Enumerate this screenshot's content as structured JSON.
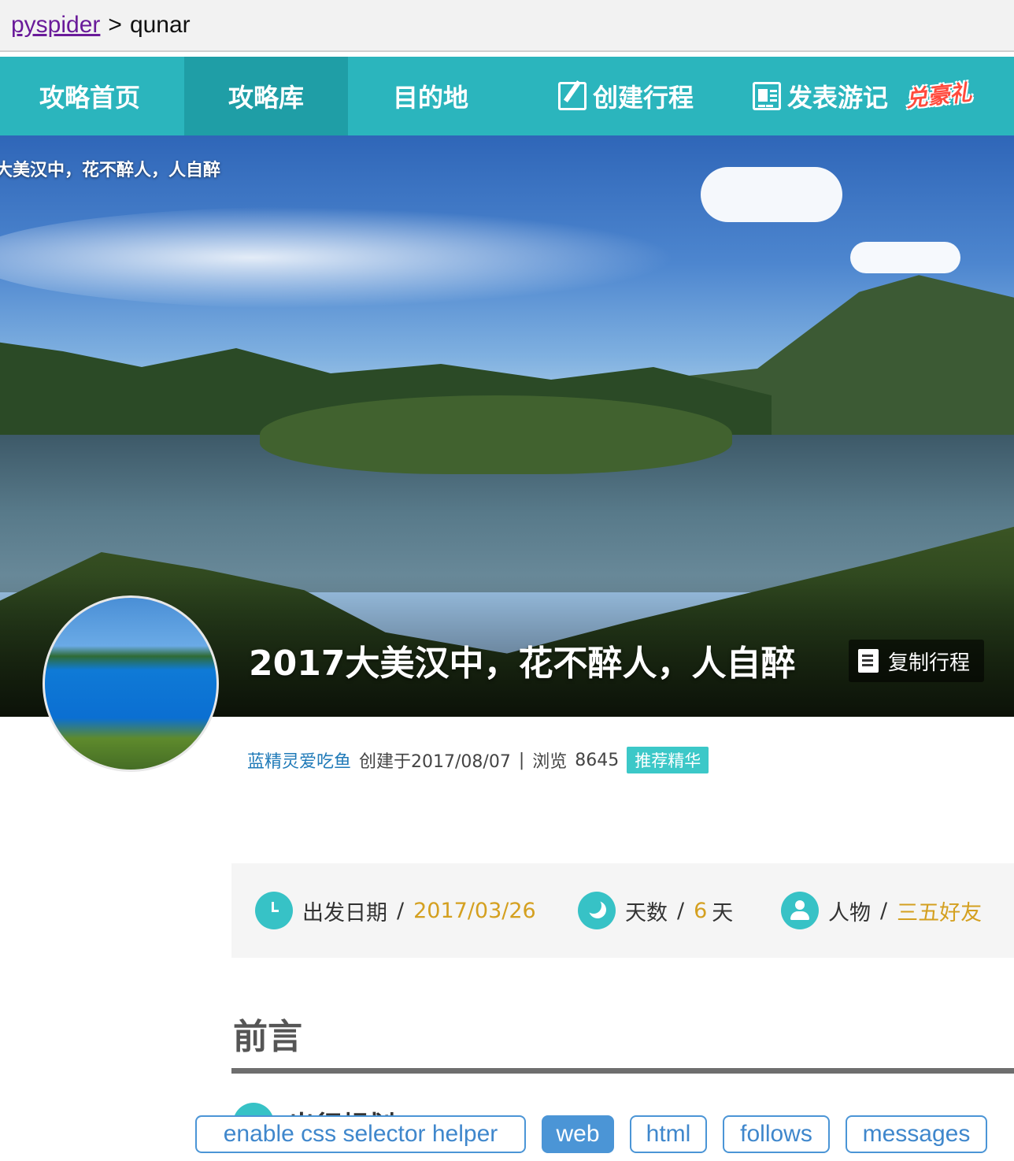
{
  "breadcrumb": {
    "root": "pyspider",
    "separator": ">",
    "current": "qunar"
  },
  "nav": {
    "items": [
      "攻略首页",
      "攻略库",
      "目的地",
      "创建行程",
      "发表游记"
    ],
    "active": "攻略库",
    "promo": "兑豪礼"
  },
  "hero": {
    "small_title": "大美汉中，花不醉人，人自醉",
    "title": "2017大美汉中，花不醉人，人自醉",
    "copy_button": "复制行程"
  },
  "meta": {
    "author": "蓝精灵爱吃鱼",
    "created": "创建于2017/08/07",
    "divider": "|",
    "views_label": "浏览",
    "views": "8645",
    "badge": "推荐精华"
  },
  "info": {
    "date_label": "出发日期",
    "date_value": "2017/03/26",
    "days_label": "天数",
    "days_value": "6",
    "days_unit": "天",
    "people_label": "人物",
    "people_value": "三五好友",
    "slash": "/"
  },
  "content": {
    "preface_title": "前言",
    "section_title": "出行规划"
  },
  "toolbar": {
    "css_helper": "enable css selector helper",
    "web": "web",
    "html": "html",
    "follows": "follows",
    "messages": "messages"
  },
  "colors": {
    "nav_bg": "#2bb5bd",
    "nav_active": "#1f9ea6",
    "accent_teal": "#37c2c6",
    "value_gold": "#d4a020",
    "link_blue": "#1f7ab8",
    "button_blue": "#4b95d6"
  },
  "icons": [
    "edit-icon",
    "document-icon",
    "copy-icon",
    "clock-icon",
    "moon-icon",
    "person-icon"
  ]
}
